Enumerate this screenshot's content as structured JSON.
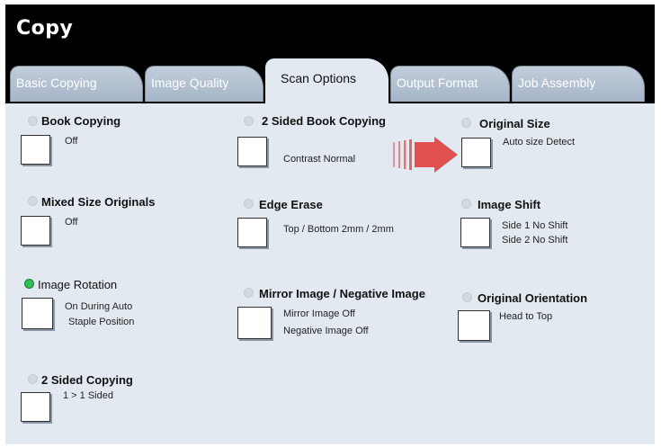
{
  "window": {
    "title": "Copy"
  },
  "tabs": [
    {
      "label": "Basic Copying"
    },
    {
      "label": "Image Quality"
    },
    {
      "label": "Scan Options",
      "active": true
    },
    {
      "label": "Output Format"
    },
    {
      "label": "Job Assembly"
    }
  ],
  "options": {
    "book_copying": {
      "label": "Book Copying",
      "value": "Off"
    },
    "two_sided_book_copying": {
      "label": "2 Sided Book Copying",
      "value": "Contrast Normal"
    },
    "original_size": {
      "label": "Original Size",
      "value": "Auto size Detect"
    },
    "mixed_size_originals": {
      "label": "Mixed Size Originals",
      "value": "Off"
    },
    "edge_erase": {
      "label": "Edge Erase",
      "value": "Top / Bottom 2mm / 2mm"
    },
    "image_shift": {
      "label": "Image Shift",
      "value_line1": "Side 1 No Shift",
      "value_line2": "Side 2 No Shift"
    },
    "image_rotation": {
      "label": "Image Rotation",
      "value_line1": "On During Auto",
      "value_line2": "Staple Position",
      "selected": true
    },
    "mirror_negative_image": {
      "label": "Mirror Image / Negative Image",
      "value_line1": "Mirror Image Off",
      "value_line2": "Negative Image Off"
    },
    "original_orientation": {
      "label": "Original Orientation",
      "value": "Head to Top"
    },
    "two_sided_copying": {
      "label": "2 Sided Copying",
      "value": "1 > 1 Sided"
    }
  },
  "colors": {
    "panel": "#e3e9f0",
    "tab_inactive": "#b4c2d2",
    "selected_indicator": "#2fbf56",
    "arrow": "#e05050"
  }
}
